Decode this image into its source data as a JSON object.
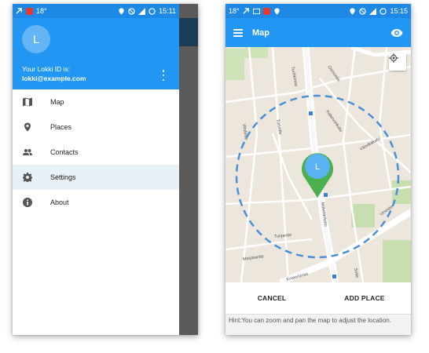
{
  "left_screen": {
    "status": {
      "time": "15:11",
      "left_text": "18°"
    },
    "user": {
      "avatar_letter": "L",
      "id_label": "Your Lokki ID is:",
      "email": "lokki@example.com"
    },
    "menu": [
      {
        "label": "Map",
        "icon": "map-icon",
        "selected": false
      },
      {
        "label": "Places",
        "icon": "place-pin-icon",
        "selected": false
      },
      {
        "label": "Contacts",
        "icon": "people-icon",
        "selected": false
      },
      {
        "label": "Settings",
        "icon": "gear-icon",
        "selected": true
      },
      {
        "label": "About",
        "icon": "info-icon",
        "selected": false
      }
    ]
  },
  "right_screen": {
    "status": {
      "time": "15:15",
      "left_text": "18°"
    },
    "appbar": {
      "title": "Map"
    },
    "map": {
      "marker_letter": "L",
      "streets": [
        "Tuohirinne",
        "Osmontie",
        "Kalervonkatu",
        "Vihdintie",
        "Turuntie",
        "Vänrikäkatu",
        "Ursintie",
        "Mäkelänkatu",
        "Tunjantie",
        "Marjatantie",
        "Koskelantie",
        "Sofie"
      ]
    },
    "actions": {
      "cancel": "CANCEL",
      "add_place": "ADD PLACE"
    },
    "hint": "Hint:You can zoom and pan the map to adjust the location."
  },
  "colors": {
    "primary": "#2196f3",
    "marker_green": "#4caf50",
    "selected_row": "#e9f1f8"
  }
}
